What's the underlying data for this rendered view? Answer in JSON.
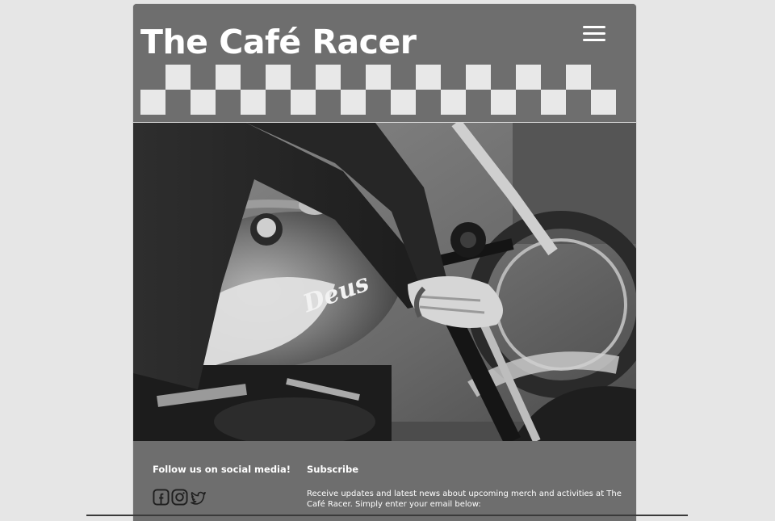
{
  "header": {
    "title": "The Café Racer",
    "menu_icon": "hamburger-menu-icon"
  },
  "hero": {
    "tank_logo_text": "Deus"
  },
  "footer": {
    "social_heading": "Follow us on social media!",
    "social_icons": [
      "facebook-icon",
      "instagram-icon",
      "twitter-icon"
    ],
    "subscribe_heading": "Subscribe",
    "subscribe_text": "Receive updates and latest news about upcoming merch and activities at The Café Racer. Simply enter your email below:"
  },
  "colors": {
    "page_background": "#e6e6e6",
    "card_background": "#6e6e6e",
    "checker_light": "#e8e8e8",
    "text": "#ffffff"
  }
}
